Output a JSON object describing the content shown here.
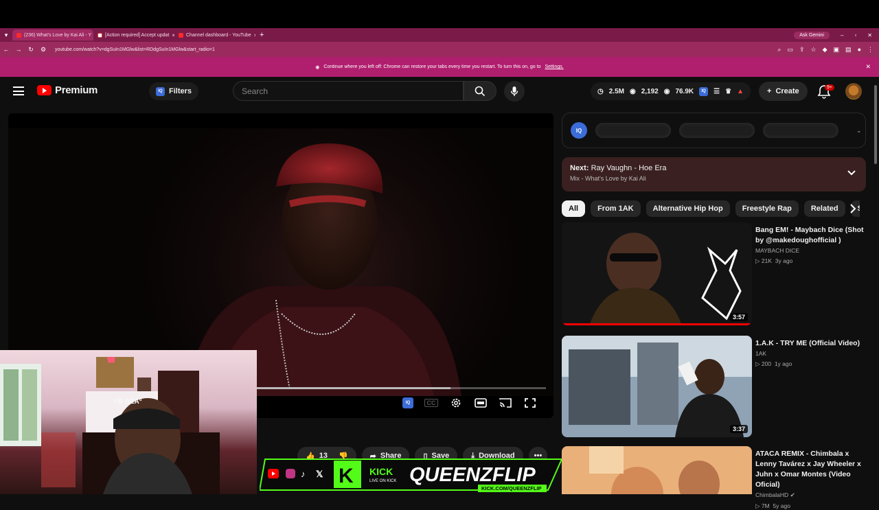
{
  "browser": {
    "tabs": [
      {
        "title": "(236) What's Love by Kai Ali - Y"
      },
      {
        "title": "[Action required] Accept updat"
      },
      {
        "title": "Channel dashboard - YouTube"
      }
    ],
    "gemini": "Ask Gemini",
    "url": "youtube.com/watch?v=dgSuIn1MGlw&list=RDdgSuIn1MGlw&start_radio=1",
    "infobar": {
      "text": "Continue where you left off: Chrome can restore your tabs every time you restart. To turn this on, go to",
      "link": "Settings."
    }
  },
  "header": {
    "logo": "Premium",
    "filters": "Filters",
    "search_placeholder": "Search",
    "stats": {
      "views": "2.5M",
      "watching": "2,192",
      "other": "76.9K"
    },
    "create": "Create",
    "notif_badge": "9+"
  },
  "player": {
    "progress_fraction": 0.67
  },
  "actions": {
    "likes": "13",
    "share": "Share",
    "save": "Save",
    "download": "Download"
  },
  "overlay": {
    "brand": "KICK",
    "sub": "LIVE ON KICK",
    "name": "QUEENZFLIP",
    "url": "KICK.COM/QUEENZFLIP"
  },
  "next": {
    "label": "Next:",
    "title": "Ray Vaughn - Hoe Era",
    "subtitle": "Mix - What's Love by Kai Ali"
  },
  "chips": [
    "All",
    "From 1AK",
    "Alternative Hip Hop",
    "Freestyle Rap",
    "Related",
    "Simil"
  ],
  "videos": [
    {
      "title": "Bang EM! - Maybach Dice (Shot by @makedoughofficial )",
      "channel": "MAYBACH DICE",
      "views": "21K",
      "age": "3y ago",
      "duration": "3:57"
    },
    {
      "title": "1.A.K - TRY ME (Official Video)",
      "channel": "1AK",
      "views": "200",
      "age": "1y ago",
      "duration": "3:37"
    },
    {
      "title": "ATACA REMIX - Chimbala x Lenny Tavárez x Jay Wheeler x Juhn x Omar Montes (Video Oficial)",
      "channel": "ChimbalaHD",
      "views": "7M",
      "age": "5y ago",
      "duration": ""
    }
  ],
  "colors": {
    "accent": "#ff0000",
    "chrome_tab": "#7a1a48",
    "infobar": "#b01e6e"
  }
}
